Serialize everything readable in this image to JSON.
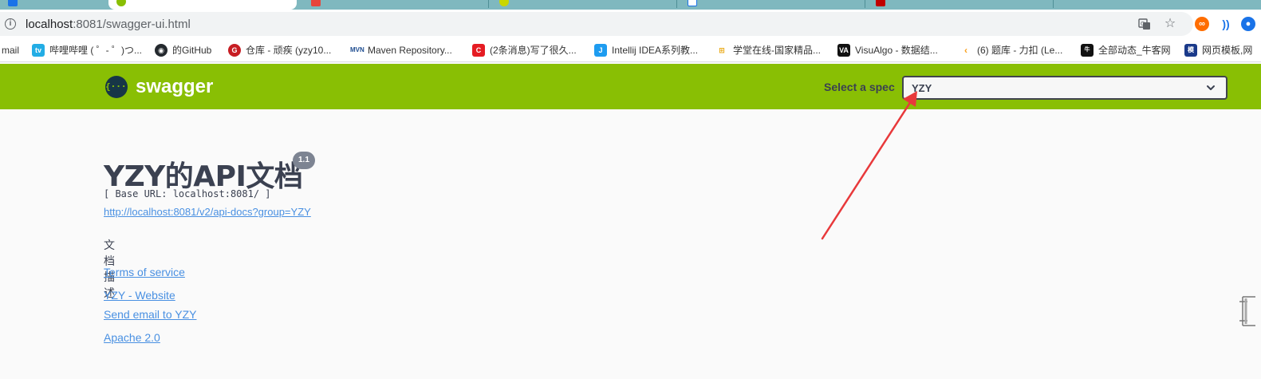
{
  "browser": {
    "tabs": [
      {
        "label": "",
        "active": false
      },
      {
        "label": "",
        "active": true
      },
      {
        "label": "",
        "active": false
      },
      {
        "label": "",
        "active": false
      },
      {
        "label": "",
        "active": false
      },
      {
        "label": "",
        "active": false
      },
      {
        "label": "",
        "active": false
      }
    ],
    "url_host": "localhost",
    "url_path": ":8081/swagger-ui.html",
    "bookmarks": [
      {
        "label": "mail",
        "icon": "mail-icon"
      },
      {
        "label": "哔哩哔哩 ( ゜- ゜)つ...",
        "icon": "bilibili-icon"
      },
      {
        "label": "的GitHub",
        "icon": "github-icon"
      },
      {
        "label": "仓库 - 顽疾 (yzy10...",
        "icon": "gitee-icon"
      },
      {
        "label": "Maven Repository...",
        "icon": "maven-icon"
      },
      {
        "label": "(2条消息)写了很久...",
        "icon": "csdn-icon"
      },
      {
        "label": "Intellij IDEA系列教...",
        "icon": "jetbrains-icon"
      },
      {
        "label": "学堂在线-国家精品...",
        "icon": "xuetang-icon"
      },
      {
        "label": "VisuAlgo - 数据结...",
        "icon": "visualgo-icon"
      },
      {
        "label": "(6) 题库 - 力扣 (Le...",
        "icon": "leetcode-icon"
      },
      {
        "label": "全部动态_牛客网",
        "icon": "nowcoder-icon"
      },
      {
        "label": "网页模板,网",
        "icon": "template-icon"
      }
    ]
  },
  "swagger": {
    "logo_text": "swagger",
    "logo_glyph": "{···}",
    "spec_label": "Select a spec",
    "spec_value": "YZY"
  },
  "info": {
    "title": "YZY的API文档",
    "version": "1.1",
    "base_url": "[ Base URL: localhost:8081/ ]",
    "api_docs_link": "http://localhost:8081/v2/api-docs?group=YZY",
    "description": "文档描述",
    "terms_link": "Terms of service",
    "website_link": "YZY - Website",
    "email_link": "Send email to YZY",
    "license_link": "Apache 2.0"
  },
  "colors": {
    "swagger_green": "#89bf04",
    "link_blue": "#4990e2",
    "annotation_red": "#e8393b",
    "text_dark": "#3b4151"
  }
}
